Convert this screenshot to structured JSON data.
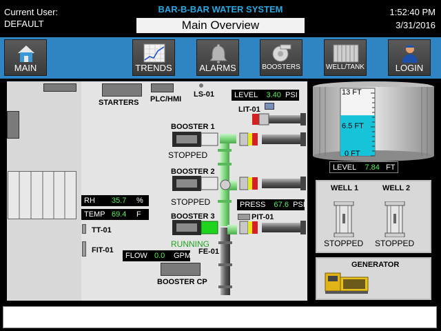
{
  "header": {
    "current_user_label": "Current User:",
    "current_user": "DEFAULT",
    "system_title": "BAR-B-BAR WATER SYSTEM",
    "screen_title": "Main Overview",
    "time": "1:52:40 PM",
    "date": "3/31/2016"
  },
  "nav": {
    "main": "MAIN",
    "trends": "TRENDS",
    "alarms": "ALARMS",
    "boosters": "BOOSTERS",
    "well_tank": "WELL/TANK",
    "login": "LOGIN"
  },
  "plant": {
    "starters": "STARTERS",
    "plc_hmi": "PLC/HMI",
    "ls01": "LS-01",
    "lit01": "LIT-01",
    "tt01": "TT-01",
    "fit01": "FIT-01",
    "pit01": "PIT-01",
    "fe01": "FE-01",
    "booster_cp": "BOOSTER CP"
  },
  "readouts": {
    "level": {
      "label": "LEVEL",
      "value": "3.40",
      "unit": "PSI"
    },
    "rh": {
      "label": "RH",
      "value": "35.7",
      "unit": "%"
    },
    "temp": {
      "label": "TEMP",
      "value": "69.4",
      "unit": "F"
    },
    "press": {
      "label": "PRESS",
      "value": "67.6",
      "unit": "PSI"
    },
    "flow": {
      "label": "FLOW",
      "value": "0.0",
      "unit": "GPM"
    },
    "tank_level": {
      "label": "LEVEL",
      "value": "7.84",
      "unit": "FT"
    }
  },
  "boosters": [
    {
      "name": "BOOSTER 1",
      "status": "STOPPED",
      "status_color": "#000000"
    },
    {
      "name": "BOOSTER 2",
      "status": "STOPPED",
      "status_color": "#000000"
    },
    {
      "name": "BOOSTER 3",
      "status": "RUNNING",
      "status_color": "#1fa31f"
    }
  ],
  "tank": {
    "ticks": [
      "13 FT",
      "6.5 FT",
      "0 FT"
    ],
    "fill_fraction": 0.6,
    "water_color": "#17c3d9"
  },
  "wells": [
    {
      "name": "WELL 1",
      "status": "STOPPED"
    },
    {
      "name": "WELL 2",
      "status": "STOPPED"
    }
  ],
  "generator": {
    "label": "GENERATOR"
  },
  "colors": {
    "accent_blue": "#2aa7df",
    "nav_bar": "#2f84c4",
    "running": "#1fa31f",
    "value_green": "#5af05a",
    "pipe_green": "#9be89b"
  },
  "icons": {
    "main": "home-icon",
    "trends": "chart-icon",
    "alarms": "bell-icon",
    "boosters": "pump-icon",
    "well_tank": "tank-icon",
    "login": "user-icon"
  }
}
